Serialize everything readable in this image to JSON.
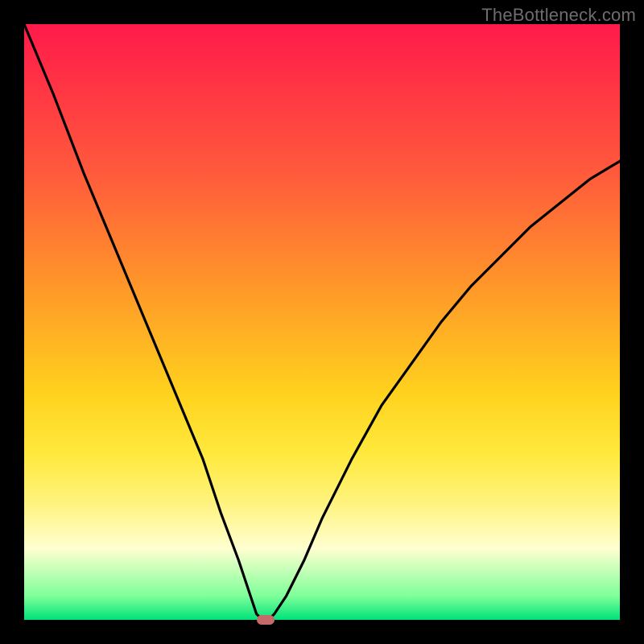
{
  "watermark": "TheBottleneck.com",
  "colors": {
    "frame": "#000000",
    "curve": "#000000",
    "marker": "#c56a6a"
  },
  "chart_data": {
    "type": "line",
    "title": "",
    "xlabel": "",
    "ylabel": "",
    "xlim": [
      0,
      100
    ],
    "ylim": [
      0,
      100
    ],
    "grid": false,
    "series": [
      {
        "name": "bottleneck-curve",
        "x": [
          0,
          5,
          10,
          15,
          20,
          25,
          30,
          33,
          36,
          38,
          39,
          40,
          41,
          42,
          44,
          47,
          50,
          55,
          60,
          65,
          70,
          75,
          80,
          85,
          90,
          95,
          100
        ],
        "values": [
          100,
          88,
          75,
          63,
          51,
          39,
          27,
          18,
          10,
          4,
          1,
          0,
          0,
          1,
          4,
          10,
          17,
          27,
          36,
          43,
          50,
          56,
          61,
          66,
          70,
          74,
          77
        ]
      }
    ],
    "annotations": [
      {
        "name": "min-marker",
        "x": 40.5,
        "y": 0
      }
    ],
    "background_gradient": {
      "orientation": "vertical",
      "stops": [
        {
          "pos": 0.0,
          "color": "#ff1a4a"
        },
        {
          "pos": 0.25,
          "color": "#ff5a3c"
        },
        {
          "pos": 0.45,
          "color": "#ff9a28"
        },
        {
          "pos": 0.62,
          "color": "#ffd21e"
        },
        {
          "pos": 0.72,
          "color": "#ffe93c"
        },
        {
          "pos": 0.8,
          "color": "#fff27a"
        },
        {
          "pos": 0.88,
          "color": "#ffffd0"
        },
        {
          "pos": 0.96,
          "color": "#7fff9a"
        },
        {
          "pos": 1.0,
          "color": "#00e27a"
        }
      ]
    }
  }
}
